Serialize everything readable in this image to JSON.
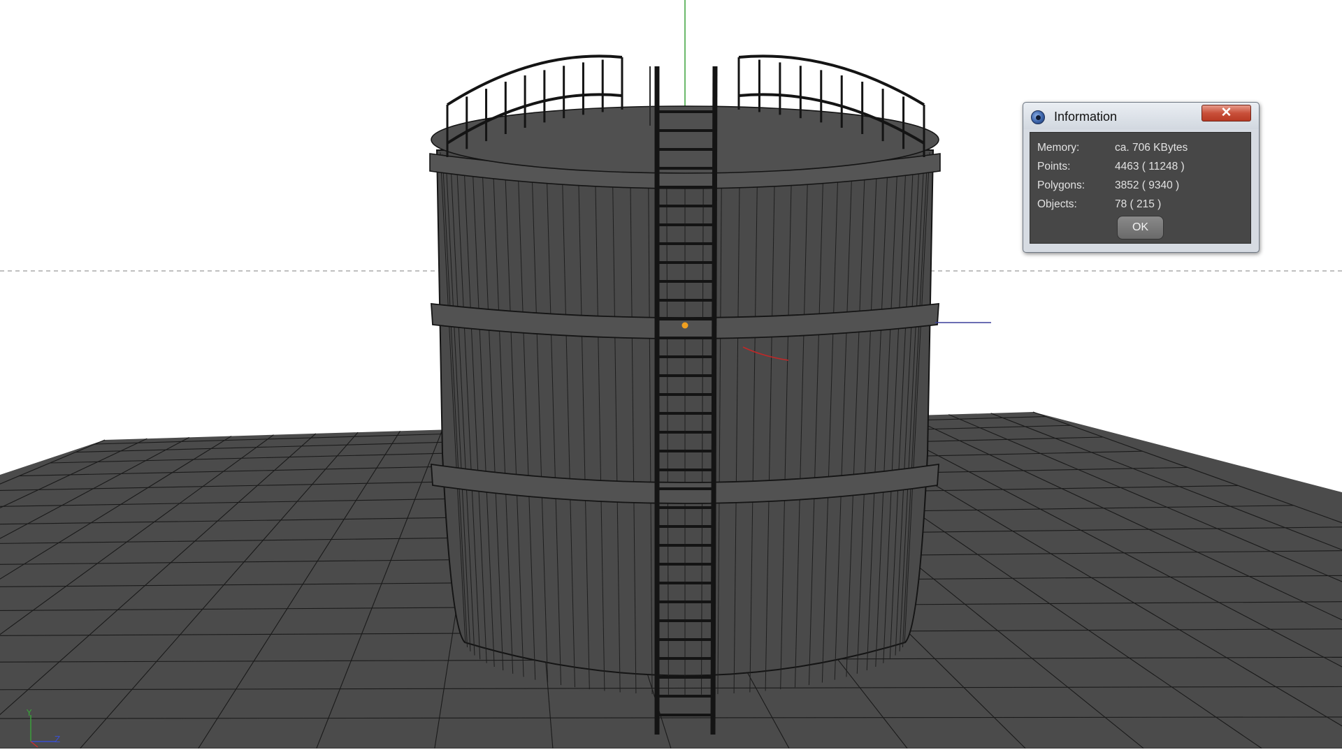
{
  "dialog": {
    "title": "Information",
    "close_glyph": "✕",
    "rows": [
      {
        "label": "Memory:",
        "value": "ca. 706 KBytes"
      },
      {
        "label": "Points:",
        "value": "4463 ( 11248 )"
      },
      {
        "label": "Polygons:",
        "value": "3852 ( 9340 )"
      },
      {
        "label": "Objects:",
        "value": "78 ( 215 )"
      }
    ],
    "ok_label": "OK"
  },
  "axis_gizmo": {
    "y_label": "Y",
    "z_label": "Z"
  },
  "icons": {
    "app": "cinema4d-logo-icon",
    "close": "close-icon"
  },
  "colors": {
    "model_fill": "#4a4a4a",
    "wire": "#141414",
    "floor": "#4b4b4b",
    "axis_y": "#3aa53a",
    "axis_x": "#c83030",
    "axis_z": "#3a4fd0",
    "object_center": "#f0a020"
  }
}
